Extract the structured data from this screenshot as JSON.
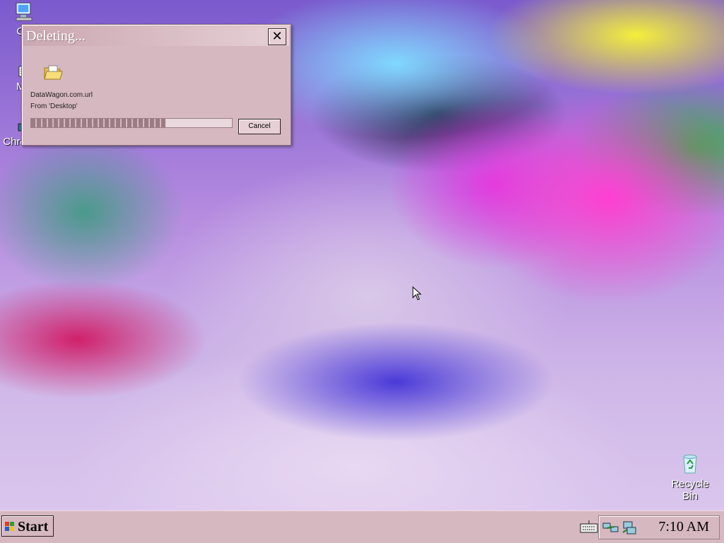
{
  "desktop": {
    "icons": [
      {
        "label": "Co"
      },
      {
        "label": "My"
      },
      {
        "label": "Chrom..."
      }
    ],
    "recycle_bin": {
      "line1": "Recycle",
      "line2": "Bin"
    }
  },
  "dialog": {
    "title": "Deleting...",
    "close_label": "✕",
    "file_name": "DataWagon.com.url",
    "from_text": "From 'Desktop'",
    "progress_fraction": 0.67,
    "cancel_label": "Cancel"
  },
  "taskbar": {
    "start_label": "Start",
    "clock": "7:10 AM"
  },
  "colors": {
    "chrome": "#d6b8c0",
    "dialog_title_text": "#ffffff"
  }
}
